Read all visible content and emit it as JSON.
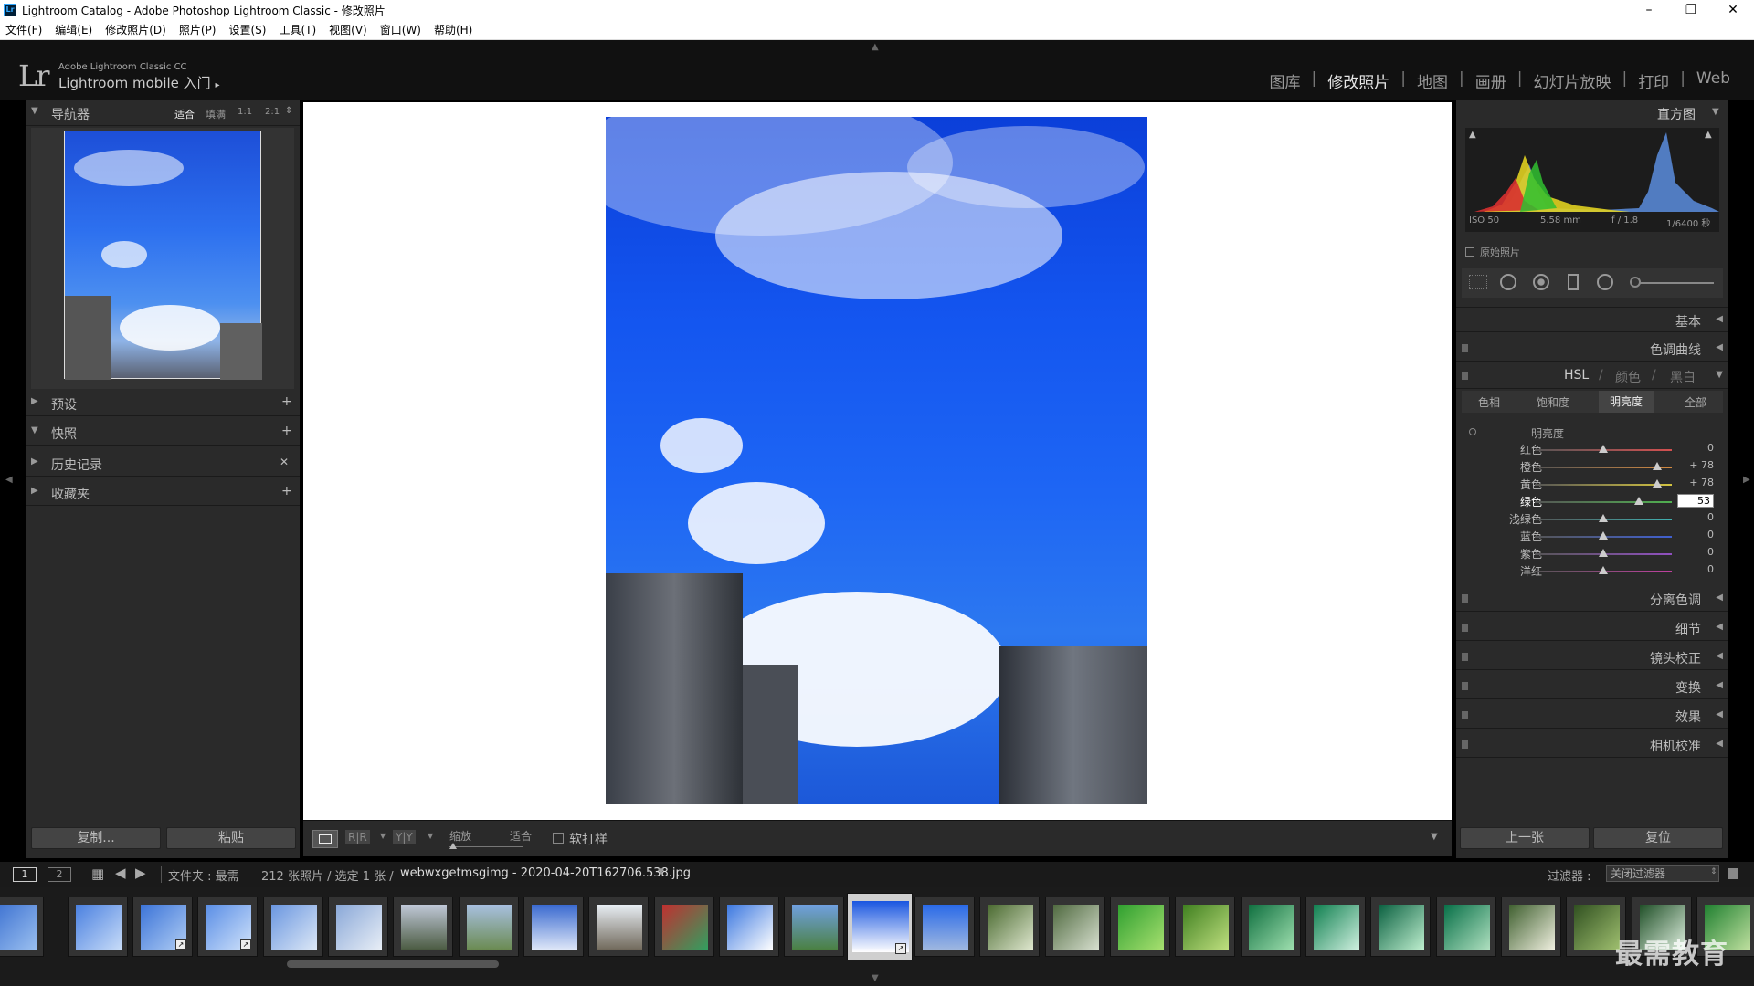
{
  "window": {
    "title": "Lightroom Catalog - Adobe Photoshop Lightroom Classic - 修改照片",
    "app_icon": "Lr",
    "min": "–",
    "max": "❐",
    "close": "✕"
  },
  "menu": [
    "文件(F)",
    "编辑(E)",
    "修改照片(D)",
    "照片(P)",
    "设置(S)",
    "工具(T)",
    "视图(V)",
    "窗口(W)",
    "帮助(H)"
  ],
  "identity": {
    "logo": "Lr",
    "product": "Adobe Lightroom Classic CC",
    "mobile": "Lightroom mobile 入门",
    "arrow": "▸"
  },
  "modules": [
    "图库",
    "修改照片",
    "地图",
    "画册",
    "幻灯片放映",
    "打印",
    "Web"
  ],
  "active_module": "修改照片",
  "left": {
    "navigator": {
      "title": "导航器",
      "modes": [
        "适合",
        "填满",
        "1:1",
        "2:1"
      ],
      "stepper": "⇕"
    },
    "panels": [
      {
        "title": "预设",
        "action": "+",
        "tri": "▶"
      },
      {
        "title": "快照",
        "action": "+",
        "tri": "▼"
      },
      {
        "title": "历史记录",
        "action": "✕",
        "tri": "▶"
      },
      {
        "title": "收藏夹",
        "action": "+",
        "tri": "▶"
      }
    ],
    "copy_button": "复制...",
    "paste_button": "粘贴"
  },
  "toolbar": {
    "zoom_label": "缩放",
    "fit_label": "适合",
    "softproof_label": "软打样",
    "loupe_icon": "loupe-view-icon",
    "before_after_1": "R|R",
    "before_after_2": "Y|Y",
    "dropdown": "▼"
  },
  "right": {
    "histogram": {
      "title": "直方图",
      "iso": "ISO 50",
      "focal": "5.58 mm",
      "aperture": "f / 1.8",
      "shutter": "1/6400 秒",
      "original": "原始照片"
    },
    "panels_top": [
      {
        "title": "基本"
      },
      {
        "title": "色调曲线"
      }
    ],
    "hsl": {
      "tabs_main": [
        "HSL",
        "颜色",
        "黑白"
      ],
      "subtabs": [
        "色相",
        "饱和度",
        "明亮度",
        "全部"
      ],
      "active_subtab": "明亮度",
      "section": "明亮度",
      "sliders": [
        {
          "label": "红色",
          "value": "0",
          "pos": 0.5,
          "color": "#d45050"
        },
        {
          "label": "橙色",
          "value": "+ 78",
          "pos": 0.89,
          "color": "#d48a40"
        },
        {
          "label": "黄色",
          "value": "+ 78",
          "pos": 0.89,
          "color": "#d4c440"
        },
        {
          "label": "绿色",
          "value": "53",
          "pos": 0.76,
          "color": "#50b050"
        },
        {
          "label": "浅绿色",
          "value": "0",
          "pos": 0.5,
          "color": "#40b0b0"
        },
        {
          "label": "蓝色",
          "value": "0",
          "pos": 0.5,
          "color": "#4060d0"
        },
        {
          "label": "紫色",
          "value": "0",
          "pos": 0.5,
          "color": "#9050c0"
        },
        {
          "label": "洋红",
          "value": "0",
          "pos": 0.5,
          "color": "#c040a0"
        }
      ]
    },
    "panels_bottom": [
      {
        "title": "分离色调"
      },
      {
        "title": "细节"
      },
      {
        "title": "镜头校正"
      },
      {
        "title": "变换"
      },
      {
        "title": "效果"
      },
      {
        "title": "相机校准"
      }
    ],
    "prev_button": "上一张",
    "reset_button": "复位"
  },
  "filmstrip_bar": {
    "screen1": "1",
    "screen2": "2",
    "folder": "文件夹 : 最需",
    "count": "212 张照片 / 选定 1 张 /",
    "filename": "webwxgetmsgimg - 2020-04-20T162706.538.jpg",
    "filter_label": "过滤器 :",
    "filter_value": "关闭过滤器"
  },
  "watermark": "最需教育",
  "colors": {
    "accent": "#e6e6e6",
    "panel": "#2a2a2a",
    "sky": "#1e5ee8"
  }
}
